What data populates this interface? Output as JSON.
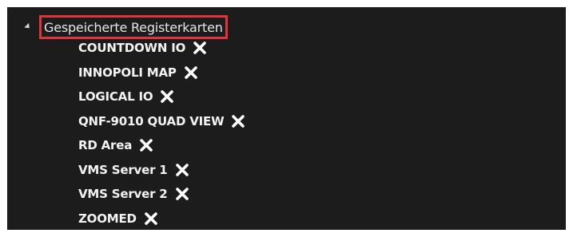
{
  "tree": {
    "header_label": "Gespeicherte Registerkarten",
    "expander_icon": "collapse-triangle-icon",
    "highlight_color": "#e0343d",
    "tabs": [
      {
        "label": "COUNTDOWN IO",
        "icon": "close-icon"
      },
      {
        "label": "INNOPOLI MAP",
        "icon": "close-icon"
      },
      {
        "label": "LOGICAL IO",
        "icon": "close-icon"
      },
      {
        "label": "QNF-9010 QUAD VIEW",
        "icon": "close-icon"
      },
      {
        "label": "RD Area",
        "icon": "close-icon"
      },
      {
        "label": "VMS Server 1",
        "icon": "close-icon"
      },
      {
        "label": "VMS Server 2",
        "icon": "close-icon"
      },
      {
        "label": "ZOOMED",
        "icon": "close-icon"
      }
    ]
  }
}
